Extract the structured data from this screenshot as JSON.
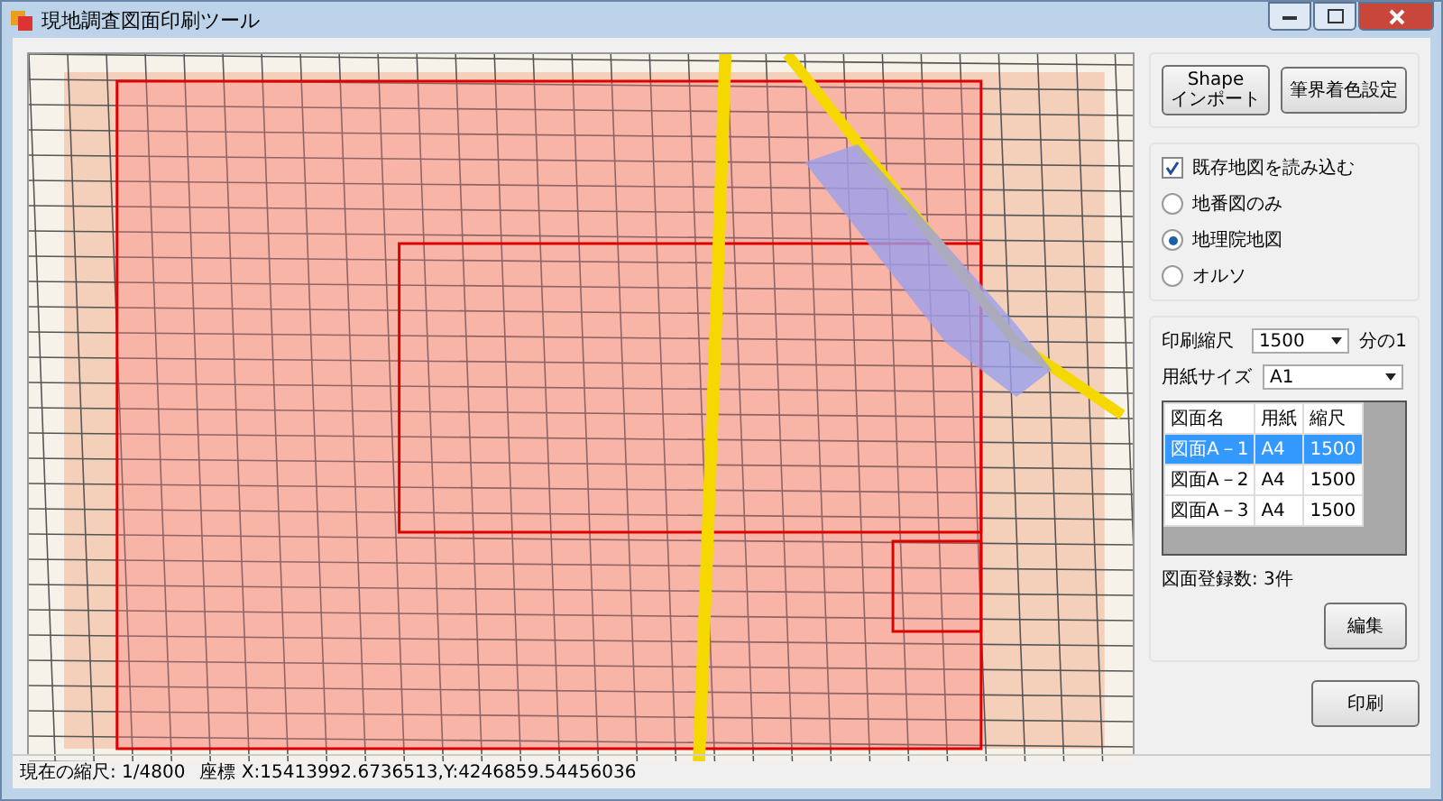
{
  "window": {
    "title": "現地調査図面印刷ツール"
  },
  "top_buttons": [
    "Shape\nインポート",
    "筆界着色設定"
  ],
  "load_existing": {
    "label": "既存地図を読み込む",
    "checked": true
  },
  "map_types": [
    {
      "label": "地番図のみ",
      "selected": false
    },
    {
      "label": "地理院地図",
      "selected": true
    },
    {
      "label": "オルソ",
      "selected": false
    }
  ],
  "print_scale": {
    "label": "印刷縮尺",
    "value": "1500",
    "suffix": "分の1"
  },
  "paper_size": {
    "label": "用紙サイズ",
    "value": "A1"
  },
  "table": {
    "columns": [
      "図面名",
      "用紙",
      "縮尺"
    ],
    "rows": [
      {
        "cells": [
          "図面A－1",
          "A4",
          "1500"
        ],
        "selected": true
      },
      {
        "cells": [
          "図面A－2",
          "A4",
          "1500"
        ],
        "selected": false
      },
      {
        "cells": [
          "図面A－3",
          "A4",
          "1500"
        ],
        "selected": false
      }
    ]
  },
  "count": "図面登録数: 3件",
  "edit_button": "編集",
  "print_button": "印刷",
  "status_bar": {
    "scale": "現在の縮尺: 1/4800",
    "coords": "座標 X:15413992.6736513,Y:4246859.54456036"
  }
}
